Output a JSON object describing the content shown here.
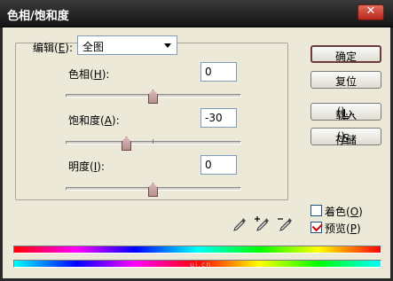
{
  "window": {
    "title": "色相/饱和度",
    "close_icon": "close-icon"
  },
  "edit": {
    "label": "编辑",
    "mnemonic": "E",
    "selected": "全图"
  },
  "hue": {
    "label": "色相",
    "mnemonic": "H",
    "value": "0"
  },
  "saturation": {
    "label": "饱和度",
    "mnemonic": "A",
    "value": "-30"
  },
  "lightness": {
    "label": "明度",
    "mnemonic": "I",
    "value": "0"
  },
  "buttons": {
    "ok": "确定",
    "reset": "复位",
    "load_text": "载入",
    "load_mnemonic": "L",
    "save_text": "存储",
    "save_mnemonic": "S"
  },
  "colorize": {
    "text": "着色",
    "mnemonic": "O",
    "checked": false
  },
  "preview": {
    "text": "预览",
    "mnemonic": "P",
    "checked": true
  },
  "watermark": "ui.cn",
  "colors": {
    "titlebar": "#141414",
    "thumb": "#c4a0a0",
    "check": "#cc0000"
  }
}
